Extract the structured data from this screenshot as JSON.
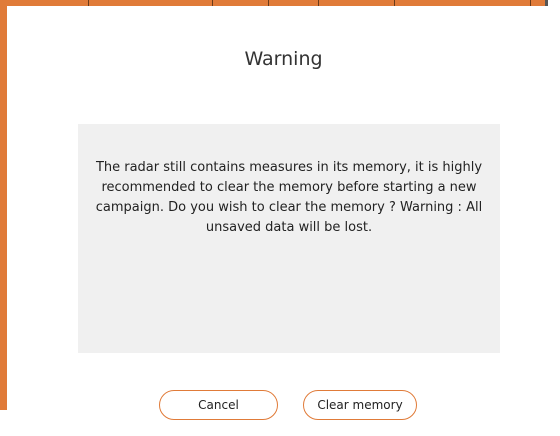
{
  "dialog": {
    "title": "Warning",
    "message": "The radar still contains measures in its memory, it is highly recommended to clear the memory before starting a new campaign. Do you wish to clear the memory ? Warning : All unsaved data will be lost.",
    "buttons": {
      "cancel_label": "Cancel",
      "clear_label": "Clear memory"
    }
  },
  "colors": {
    "accent": "#e07b39",
    "message_background": "#f0f0f0"
  }
}
